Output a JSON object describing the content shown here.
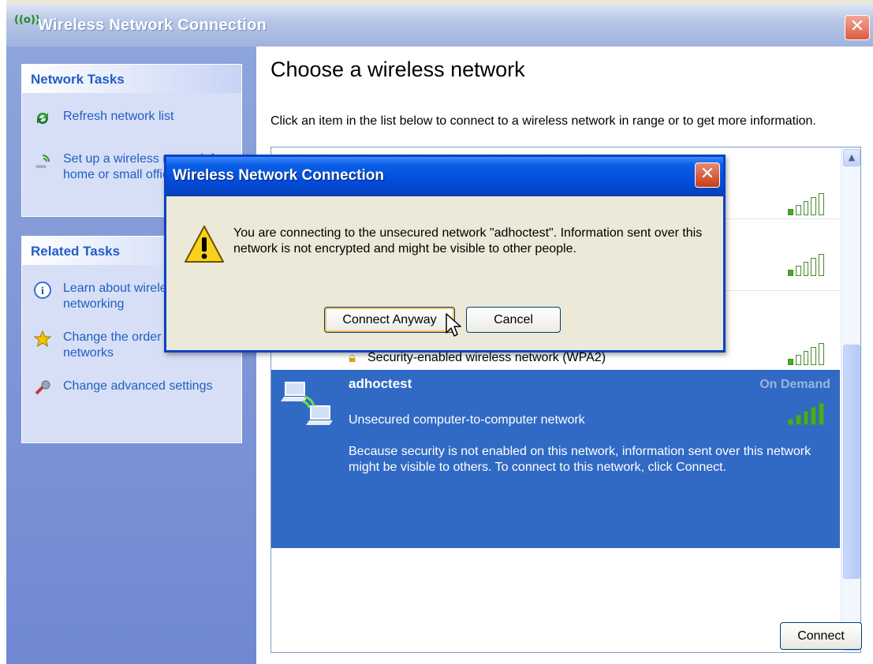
{
  "window": {
    "title": "Wireless Network Connection",
    "title_icon": "((o))",
    "close_label": "✕"
  },
  "sidebar": {
    "network_tasks": {
      "heading": "Network Tasks",
      "items": [
        {
          "label": "Refresh network list",
          "icon": "refresh-icon"
        },
        {
          "label": "Set up a wireless network for a home or small office",
          "icon": "wireless-setup-icon"
        }
      ]
    },
    "related_tasks": {
      "heading": "Related Tasks",
      "items": [
        {
          "label": "Learn about wireless networking",
          "icon": "info-icon"
        },
        {
          "label": "Change the order of preferred networks",
          "icon": "star-icon"
        },
        {
          "label": "Change advanced settings",
          "icon": "settings-icon"
        }
      ]
    }
  },
  "main": {
    "heading": "Choose a wireless network",
    "intro": "Click an item in the list below to connect to a wireless network in range or to get more information.",
    "networks": [
      {
        "type_label": "",
        "signal_bars": 1
      },
      {
        "type_label": "",
        "signal_bars": 1
      },
      {
        "type_label": "Security-enabled wireless network (WPA2)",
        "signal_bars": 1
      },
      {
        "name": "adhoctest",
        "status": "On Demand",
        "type_label": "Unsecured computer-to-computer network",
        "description": "Because security is not enabled on this network, information sent over this network might be visible to others. To connect to this network, click Connect.",
        "signal_bars": 5,
        "selected": true
      }
    ],
    "connect_button": "Connect"
  },
  "dialog": {
    "title": "Wireless Network Connection",
    "close_label": "✕",
    "message": "You are connecting to the unsecured network \"adhoctest\". Information sent over this network is not encrypted and might be visible to other people.",
    "buttons": {
      "connect_anyway": "Connect Anyway",
      "cancel": "Cancel"
    }
  },
  "colors": {
    "selection": "#316ac5",
    "dialog_title": "#0149d6",
    "task_link": "#215dc6",
    "left_panel": "#7a92d6"
  }
}
